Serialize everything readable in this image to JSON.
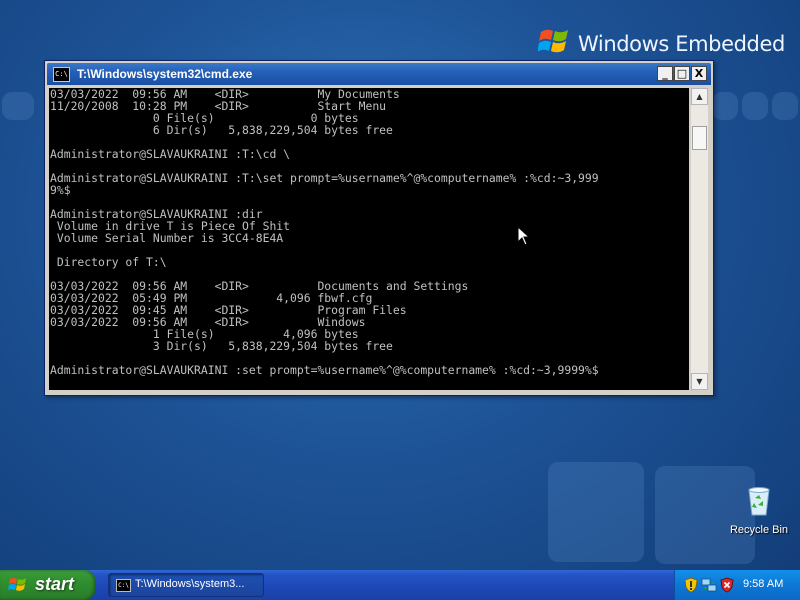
{
  "desktop": {
    "logo_text": "Windows Embedded",
    "recycle_bin_label": "Recycle Bin"
  },
  "cmd_window": {
    "title": "T:\\Windows\\system32\\cmd.exe",
    "icon_text": "C:\\",
    "minimize_symbol": "_",
    "maximize_symbol": "□",
    "close_symbol": "X",
    "console_lines": [
      "03/03/2022  09:56 AM    <DIR>          My Documents",
      "11/20/2008  10:28 PM    <DIR>          Start Menu",
      "               0 File(s)              0 bytes",
      "               6 Dir(s)   5,838,229,504 bytes free",
      "",
      "Administrator@SLAVAUKRAINI :T:\\cd \\",
      "",
      "Administrator@SLAVAUKRAINI :T:\\set prompt=%username%^@%computername% :%cd:~3,999",
      "9%$",
      "",
      "Administrator@SLAVAUKRAINI :dir",
      " Volume in drive T is Piece Of Shit",
      " Volume Serial Number is 3CC4-8E4A",
      "",
      " Directory of T:\\",
      "",
      "03/03/2022  09:56 AM    <DIR>          Documents and Settings",
      "03/03/2022  05:49 PM             4,096 fbwf.cfg",
      "03/03/2022  09:45 AM    <DIR>          Program Files",
      "03/03/2022  09:56 AM    <DIR>          Windows",
      "               1 File(s)          4,096 bytes",
      "               3 Dir(s)   5,838,229,504 bytes free",
      "",
      "Administrator@SLAVAUKRAINI :set prompt=%username%^@%computername% :%cd:~3,9999%$"
    ],
    "scroll_up_symbol": "▲",
    "scroll_down_symbol": "▼"
  },
  "taskbar": {
    "start_label": "start",
    "task_button_label": "T:\\Windows\\system3...",
    "task_icon_text": "C:\\",
    "clock": "9:58 AM"
  }
}
